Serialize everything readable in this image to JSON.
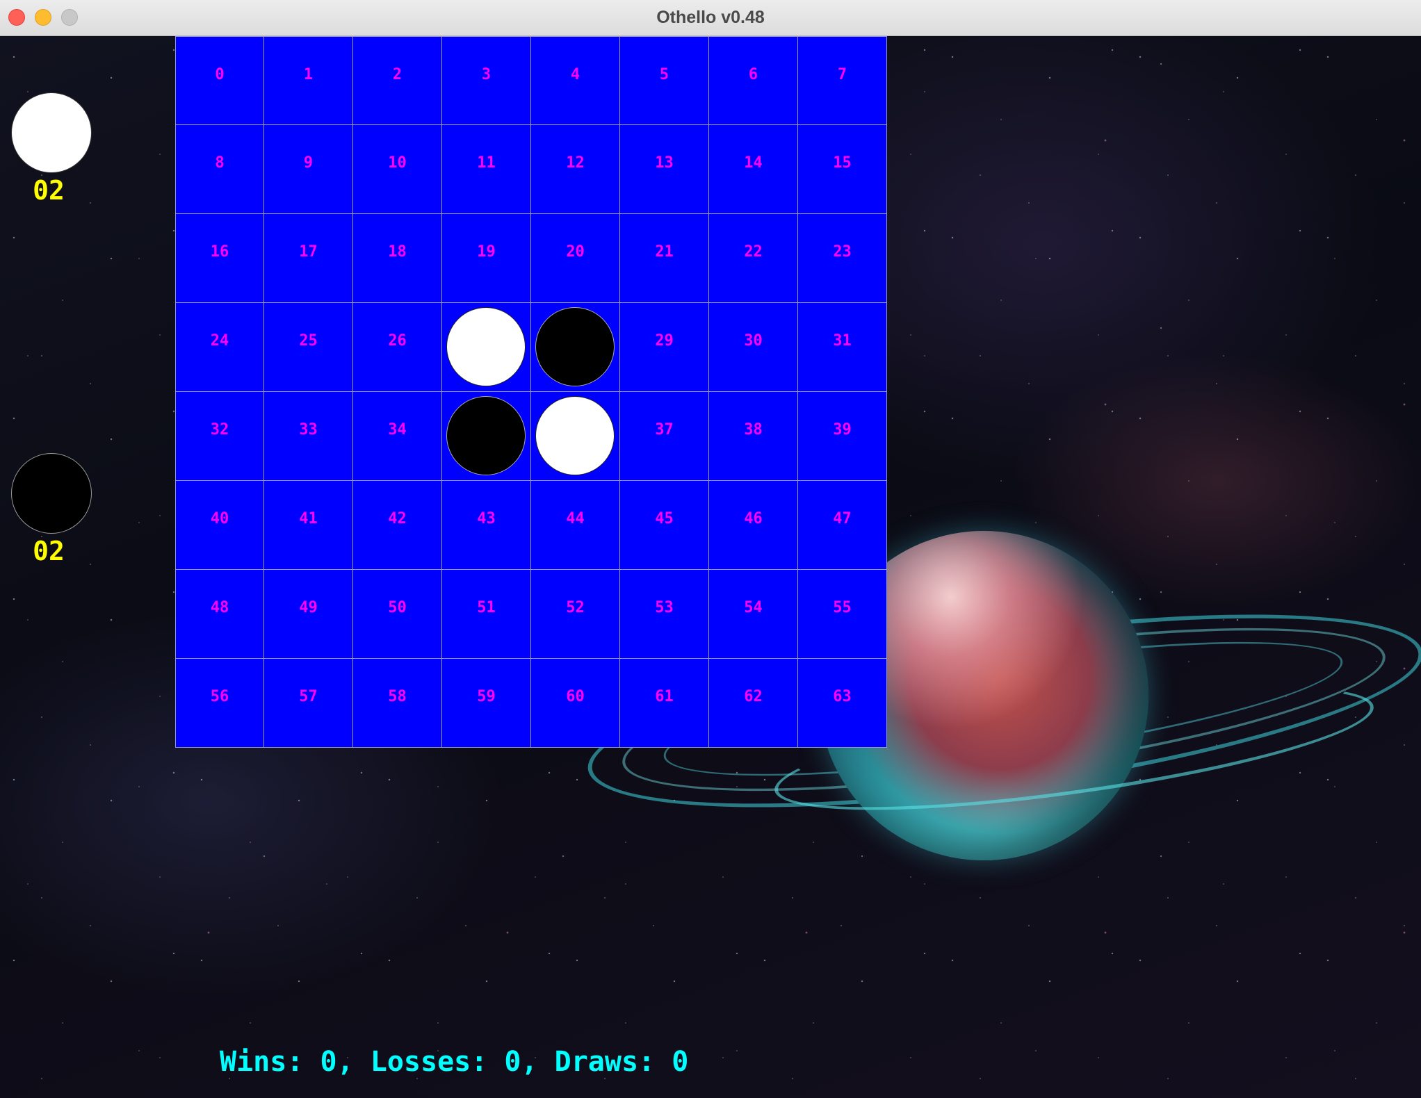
{
  "window": {
    "title": "Othello v0.48"
  },
  "scoreboard": {
    "white": {
      "disc": "white",
      "count": "02"
    },
    "black": {
      "disc": "black",
      "count": "02"
    }
  },
  "board": {
    "rows": 8,
    "cols": 8,
    "cell_color": "#0000ff",
    "label_color": "#ff00ff",
    "cells": [
      {
        "label": "0",
        "piece": null
      },
      {
        "label": "1",
        "piece": null
      },
      {
        "label": "2",
        "piece": null
      },
      {
        "label": "3",
        "piece": null
      },
      {
        "label": "4",
        "piece": null
      },
      {
        "label": "5",
        "piece": null
      },
      {
        "label": "6",
        "piece": null
      },
      {
        "label": "7",
        "piece": null
      },
      {
        "label": "8",
        "piece": null
      },
      {
        "label": "9",
        "piece": null
      },
      {
        "label": "10",
        "piece": null
      },
      {
        "label": "11",
        "piece": null
      },
      {
        "label": "12",
        "piece": null
      },
      {
        "label": "13",
        "piece": null
      },
      {
        "label": "14",
        "piece": null
      },
      {
        "label": "15",
        "piece": null
      },
      {
        "label": "16",
        "piece": null
      },
      {
        "label": "17",
        "piece": null
      },
      {
        "label": "18",
        "piece": null
      },
      {
        "label": "19",
        "piece": null
      },
      {
        "label": "20",
        "piece": null
      },
      {
        "label": "21",
        "piece": null
      },
      {
        "label": "22",
        "piece": null
      },
      {
        "label": "23",
        "piece": null
      },
      {
        "label": "24",
        "piece": null
      },
      {
        "label": "25",
        "piece": null
      },
      {
        "label": "26",
        "piece": null
      },
      {
        "label": "",
        "piece": "white"
      },
      {
        "label": "",
        "piece": "black"
      },
      {
        "label": "29",
        "piece": null
      },
      {
        "label": "30",
        "piece": null
      },
      {
        "label": "31",
        "piece": null
      },
      {
        "label": "32",
        "piece": null
      },
      {
        "label": "33",
        "piece": null
      },
      {
        "label": "34",
        "piece": null
      },
      {
        "label": "",
        "piece": "black"
      },
      {
        "label": "",
        "piece": "white"
      },
      {
        "label": "37",
        "piece": null
      },
      {
        "label": "38",
        "piece": null
      },
      {
        "label": "39",
        "piece": null
      },
      {
        "label": "40",
        "piece": null
      },
      {
        "label": "41",
        "piece": null
      },
      {
        "label": "42",
        "piece": null
      },
      {
        "label": "43",
        "piece": null
      },
      {
        "label": "44",
        "piece": null
      },
      {
        "label": "45",
        "piece": null
      },
      {
        "label": "46",
        "piece": null
      },
      {
        "label": "47",
        "piece": null
      },
      {
        "label": "48",
        "piece": null
      },
      {
        "label": "49",
        "piece": null
      },
      {
        "label": "50",
        "piece": null
      },
      {
        "label": "51",
        "piece": null
      },
      {
        "label": "52",
        "piece": null
      },
      {
        "label": "53",
        "piece": null
      },
      {
        "label": "54",
        "piece": null
      },
      {
        "label": "55",
        "piece": null
      },
      {
        "label": "56",
        "piece": null
      },
      {
        "label": "57",
        "piece": null
      },
      {
        "label": "58",
        "piece": null
      },
      {
        "label": "59",
        "piece": null
      },
      {
        "label": "60",
        "piece": null
      },
      {
        "label": "61",
        "piece": null
      },
      {
        "label": "62",
        "piece": null
      },
      {
        "label": "63",
        "piece": null
      }
    ]
  },
  "record": {
    "text": "Wins: 0, Losses: 0, Draws: 0"
  },
  "colors": {
    "score_text": "#ffff00",
    "record_text": "#00ffff",
    "board": "#0000ff",
    "cell_number": "#ff00ff"
  }
}
